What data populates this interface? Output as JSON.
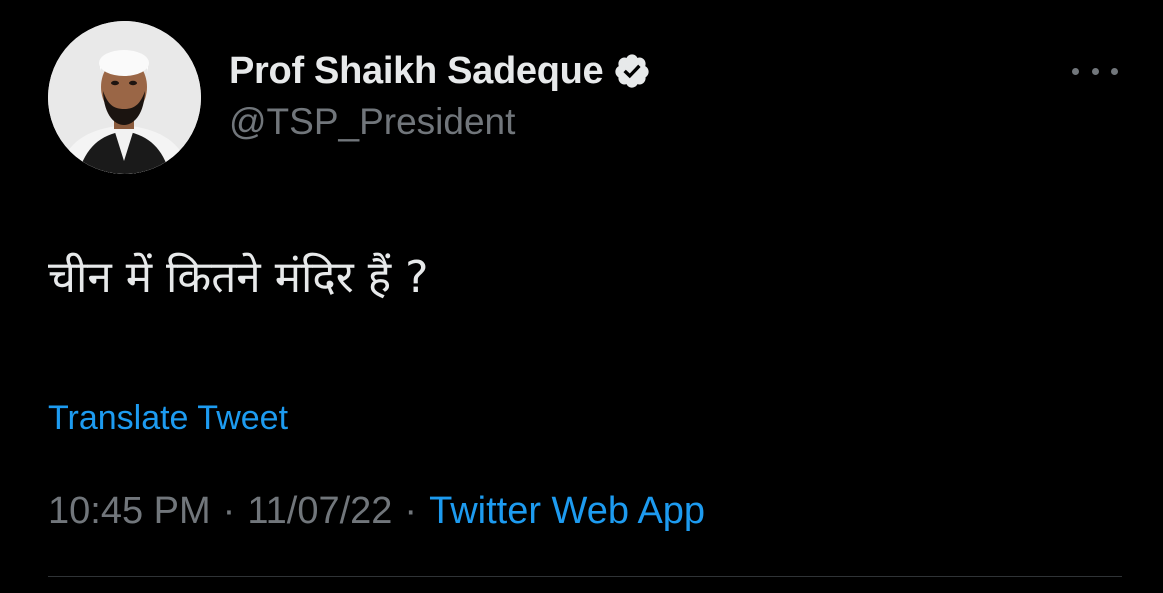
{
  "tweet": {
    "author": {
      "display_name": "Prof Shaikh Sadeque",
      "handle": "@TSP_President",
      "verified_icon": "verified-badge-icon",
      "avatar_icon": "profile-photo"
    },
    "text": "चीन में कितने मंदिर हैं ?",
    "translate_label": "Translate Tweet",
    "time": "10:45 PM",
    "date": "11/07/22",
    "separator": "·",
    "source": "Twitter Web App",
    "more_icon": "more-options-icon"
  },
  "colors": {
    "background": "#000000",
    "primary_text": "#e7e9ea",
    "secondary_text": "#71767b",
    "accent": "#1d9bf0",
    "divider": "#2f3336"
  }
}
